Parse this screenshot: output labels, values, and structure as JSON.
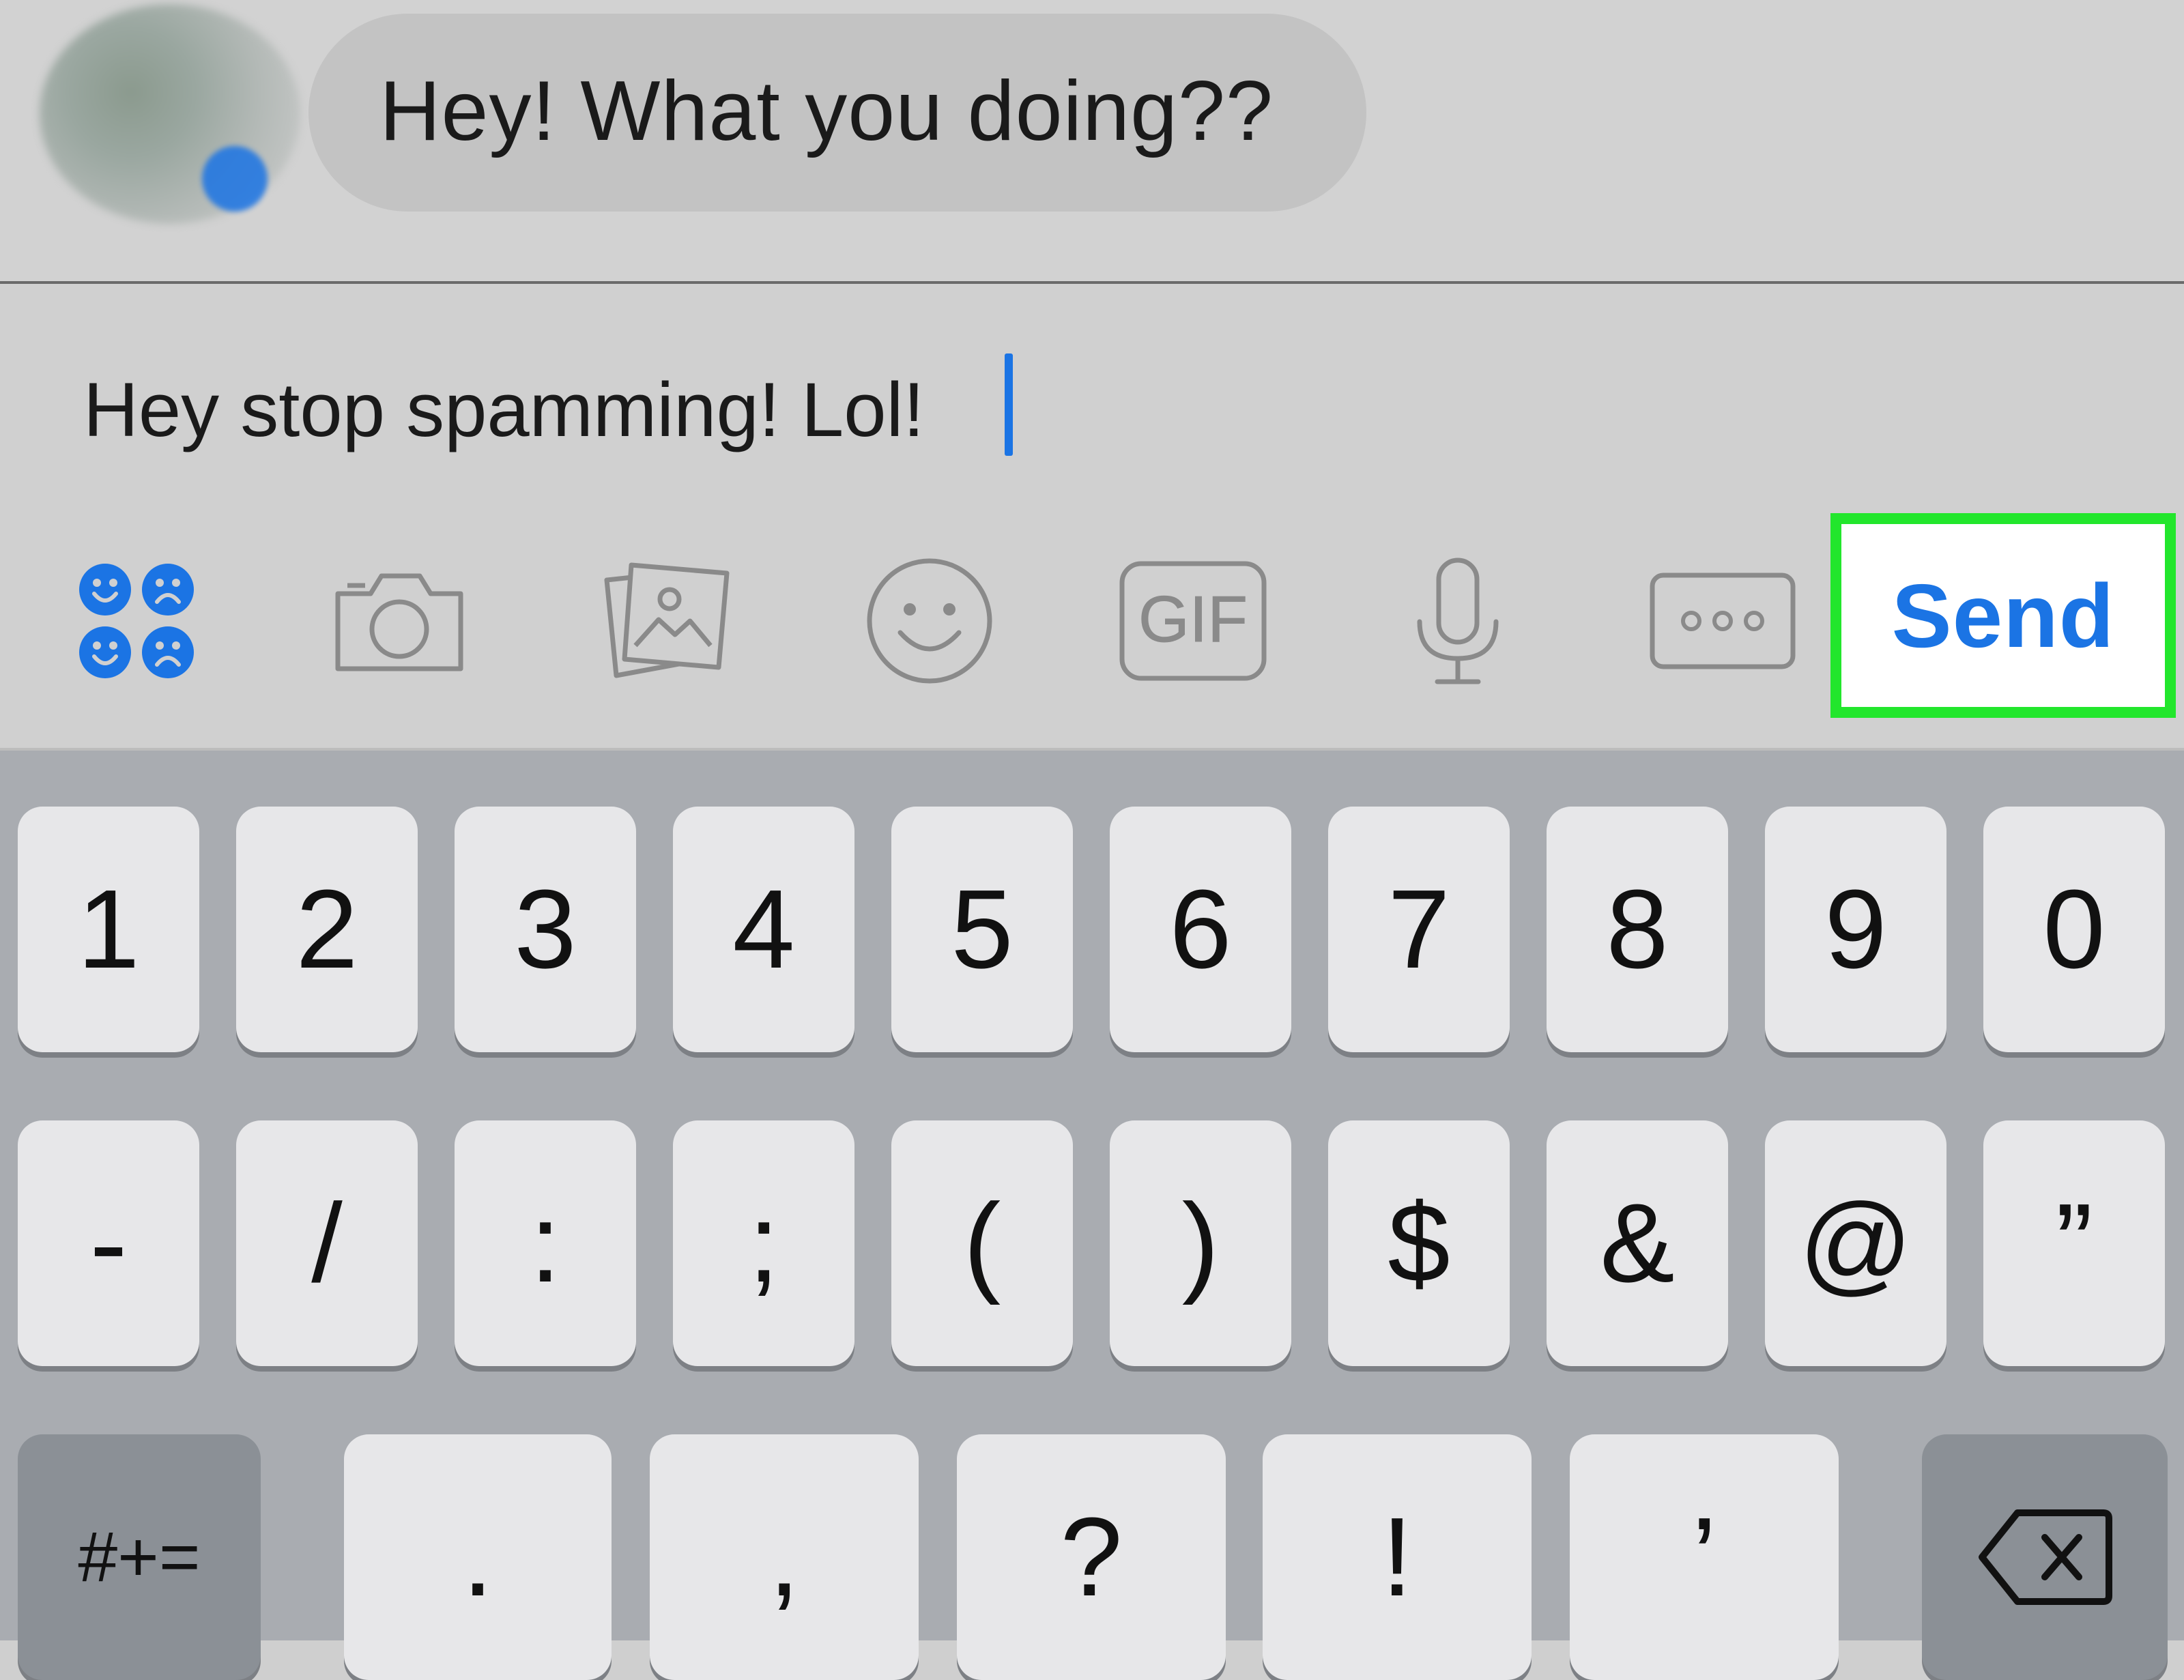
{
  "chat": {
    "incoming_message": "Hey! What you doing??"
  },
  "composer": {
    "text": "Hey stop spamming! Lol!"
  },
  "toolbar": {
    "icons": [
      "emoji-grid-icon",
      "camera-icon",
      "photo-gallery-icon",
      "smiley-icon",
      "gif-icon",
      "microphone-icon",
      "more-icon"
    ],
    "gif_label": "GIF",
    "send_label": "Send",
    "accent_color": "#1b74e4",
    "highlight_color": "#22e62c"
  },
  "keyboard": {
    "row1": [
      "1",
      "2",
      "3",
      "4",
      "5",
      "6",
      "7",
      "8",
      "9",
      "0"
    ],
    "row2": [
      "-",
      "/",
      ":",
      ";",
      "(",
      ")",
      "$",
      "&",
      "@",
      "”"
    ],
    "row3": {
      "symbols_key": "#+=",
      "keys": [
        ".",
        ",",
        "?",
        "!",
        "’"
      ],
      "delete_icon": "backspace-icon"
    }
  }
}
